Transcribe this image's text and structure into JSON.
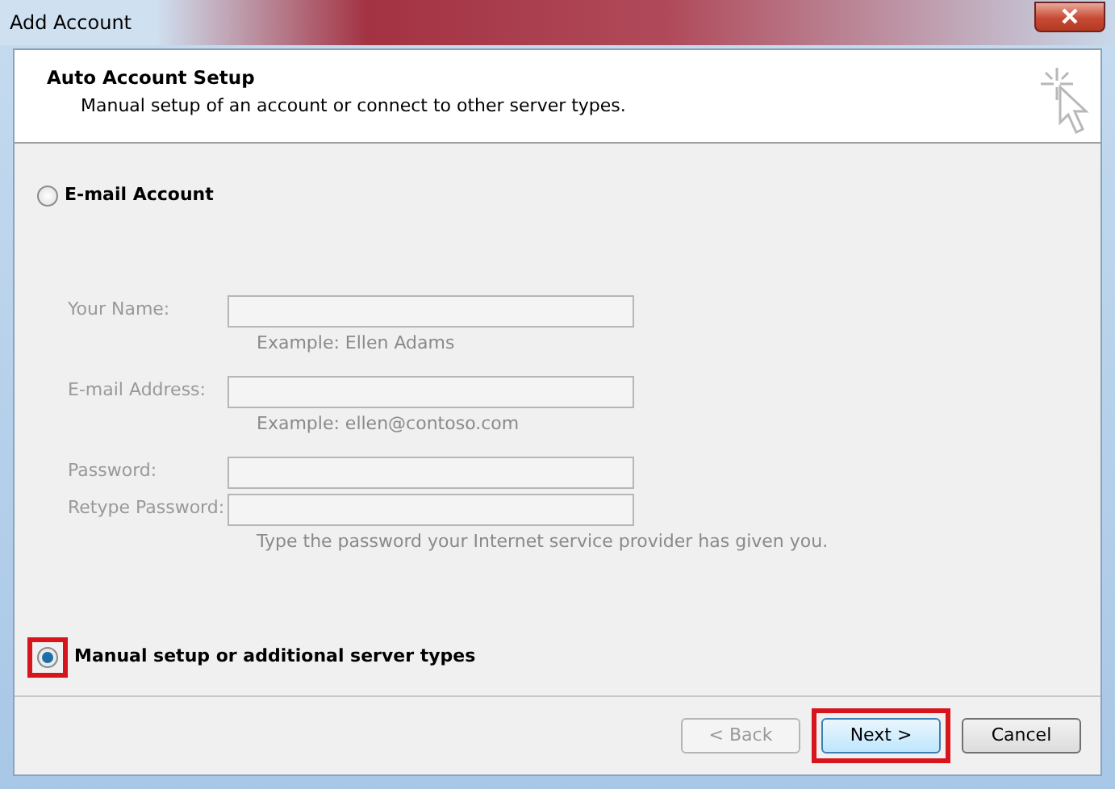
{
  "window": {
    "title": "Add Account"
  },
  "header": {
    "title": "Auto Account Setup",
    "subtitle": "Manual setup of an account or connect to other server types."
  },
  "options": [
    {
      "label": "E-mail Account",
      "selected": false,
      "highlighted": false
    },
    {
      "label": "Manual setup or additional server types",
      "selected": true,
      "highlighted": true
    }
  ],
  "fields": [
    {
      "label": "Your Name:",
      "disabled": true,
      "hint": "Example: Ellen Adams"
    },
    {
      "label": "E-mail Address:",
      "disabled": true,
      "hint": "Example: ellen@contoso.com"
    },
    {
      "label": "Password:",
      "disabled": true
    },
    {
      "label": "Retype Password:",
      "disabled": true,
      "hint": "Type the password your Internet service provider has given you."
    }
  ],
  "buttons": [
    {
      "label": "< Back",
      "disabled": true,
      "default": false,
      "highlighted": false
    },
    {
      "label": "Next >",
      "disabled": false,
      "default": true,
      "highlighted": true
    },
    {
      "label": "Cancel",
      "disabled": false,
      "default": false,
      "highlighted": false
    }
  ]
}
